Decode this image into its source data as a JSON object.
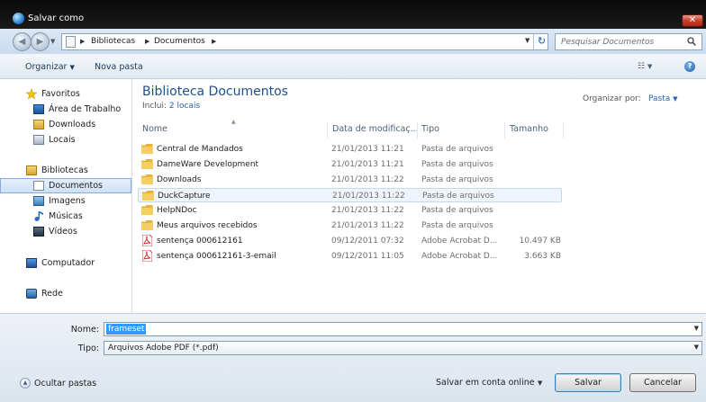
{
  "window": {
    "title": "Salvar como",
    "close_glyph": "✕"
  },
  "address": {
    "crumbs": [
      "Bibliotecas",
      "Documentos"
    ],
    "search_placeholder": "Pesquisar Documentos"
  },
  "toolbar": {
    "organize": "Organizar",
    "new_folder": "Nova pasta"
  },
  "navpane": {
    "items": [
      {
        "label": "Favoritos",
        "icon": "star-icon"
      },
      {
        "label": "Área de Trabalho",
        "icon": "desktop-icon"
      },
      {
        "label": "Downloads",
        "icon": "downloads-icon"
      },
      {
        "label": "Locais",
        "icon": "places-icon"
      },
      {
        "label": "Bibliotecas",
        "icon": "libraries-icon"
      },
      {
        "label": "Documentos",
        "icon": "documents-icon"
      },
      {
        "label": "Imagens",
        "icon": "pictures-icon"
      },
      {
        "label": "Músicas",
        "icon": "music-icon"
      },
      {
        "label": "Vídeos",
        "icon": "videos-icon"
      },
      {
        "label": "Computador",
        "icon": "computer-icon"
      },
      {
        "label": "Rede",
        "icon": "network-icon"
      }
    ]
  },
  "library": {
    "title": "Biblioteca Documentos",
    "include_label": "Inclui:",
    "include_link": "2 locais",
    "arrange_label": "Organizar por:",
    "arrange_value": "Pasta"
  },
  "columns": {
    "name": "Nome",
    "date": "Data de modificaç...",
    "type": "Tipo",
    "size": "Tamanho"
  },
  "files": [
    {
      "name": "Central de Mandados",
      "date": "21/01/2013 11:21",
      "type": "Pasta de arquivos",
      "size": "",
      "kind": "folder"
    },
    {
      "name": "DameWare Development",
      "date": "21/01/2013 11:21",
      "type": "Pasta de arquivos",
      "size": "",
      "kind": "folder"
    },
    {
      "name": "Downloads",
      "date": "21/01/2013 11:22",
      "type": "Pasta de arquivos",
      "size": "",
      "kind": "folder"
    },
    {
      "name": "DuckCapture",
      "date": "21/01/2013 11:22",
      "type": "Pasta de arquivos",
      "size": "",
      "kind": "folder"
    },
    {
      "name": "HelpNDoc",
      "date": "21/01/2013 11:22",
      "type": "Pasta de arquivos",
      "size": "",
      "kind": "folder"
    },
    {
      "name": "Meus arquivos recebidos",
      "date": "21/01/2013 11:22",
      "type": "Pasta de arquivos",
      "size": "",
      "kind": "folder"
    },
    {
      "name": "sentença 000612161",
      "date": "09/12/2011 07:32",
      "type": "Adobe Acrobat D...",
      "size": "10.497 KB",
      "kind": "pdf"
    },
    {
      "name": "sentença 000612161-3-email",
      "date": "09/12/2011 11:05",
      "type": "Adobe Acrobat D...",
      "size": "3.663 KB",
      "kind": "pdf"
    }
  ],
  "form": {
    "name_label": "Nome:",
    "name_value": "frameset",
    "type_label": "Tipo:",
    "type_value": "Arquivos Adobe PDF (*.pdf)"
  },
  "footer": {
    "hide_folders": "Ocultar pastas",
    "save_online": "Salvar em conta online",
    "save": "Salvar",
    "cancel": "Cancelar"
  },
  "colors": {
    "accent": "#2a63b0",
    "title_blue": "#1e4f8c",
    "selection": "#3399ff"
  }
}
